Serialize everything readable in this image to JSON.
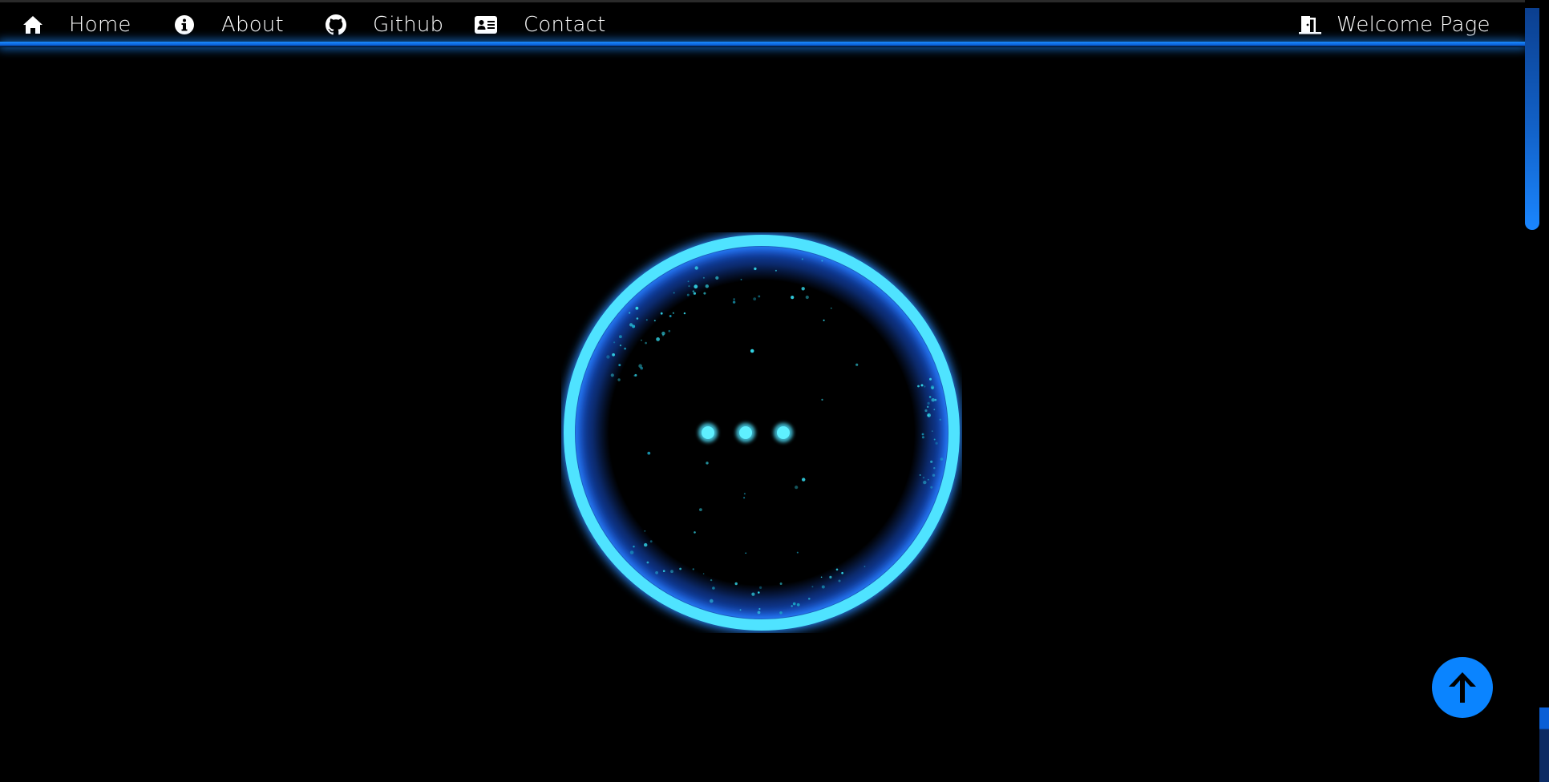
{
  "nav": {
    "items": [
      {
        "label": "Home",
        "icon": "home-icon"
      },
      {
        "label": "About",
        "icon": "info-icon"
      },
      {
        "label": "Github",
        "icon": "github-icon"
      },
      {
        "label": "Contact",
        "icon": "contact-card-icon"
      }
    ],
    "right": {
      "label": "Welcome Page",
      "icon": "door-exit-icon"
    }
  },
  "loader": {
    "icon": "loading-spinner",
    "dots": 3
  },
  "back_to_top": {
    "icon": "arrow-up-icon"
  },
  "colors": {
    "background": "#000000",
    "nav_text": "#ffffff",
    "nav_accent": "#1a8cff",
    "ring": "#4fe3ff",
    "ring_glow": "#1a6dff",
    "back_to_top": "#0a84ff"
  }
}
